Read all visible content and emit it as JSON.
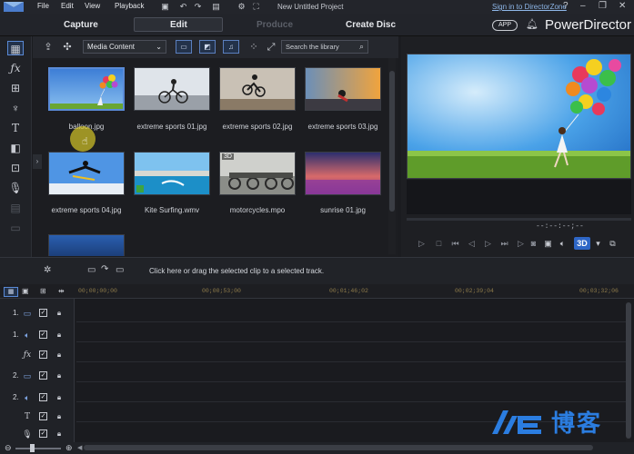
{
  "menu": [
    "File",
    "Edit",
    "View",
    "Playback"
  ],
  "window": {
    "title": "New Untitled Project",
    "signin_link": "Sign in to DirectorZone",
    "help": "?",
    "minimize": "–",
    "restore": "❐",
    "close": "✕"
  },
  "modes": {
    "capture": "Capture",
    "edit": "Edit",
    "produce": "Produce",
    "create_disc": "Create Disc"
  },
  "brand": {
    "app_badge": "APP",
    "name": "PowerDirector"
  },
  "library": {
    "dropdown_value": "Media Content",
    "search_placeholder": "Search the library",
    "items": [
      {
        "label": "balloon.jpg",
        "selected": true
      },
      {
        "label": "extreme sports 01.jpg"
      },
      {
        "label": "extreme sports 02.jpg"
      },
      {
        "label": "extreme sports 03.jpg"
      },
      {
        "label": "extreme sports 04.jpg"
      },
      {
        "label": "Kite Surfing.wmv"
      },
      {
        "label": "motorcycles.mpo",
        "badge": "3D"
      },
      {
        "label": "sunrise 01.jpg"
      }
    ]
  },
  "preview": {
    "timecode": "--:--:--;--",
    "badge_3d": "3D"
  },
  "timeline": {
    "hint": "Click here or drag the selected clip to a selected track.",
    "ruler": [
      "00;00;00;00",
      "00;00;53;00",
      "00;01;46;02",
      "00;02;39;04",
      "00;03;32;06"
    ],
    "tracks": [
      {
        "num": "1.",
        "icon": "video-track-icon"
      },
      {
        "num": "1.",
        "icon": "audio-track-icon"
      },
      {
        "num": "",
        "icon": "fx-track-icon"
      },
      {
        "num": "2.",
        "icon": "video-track-icon"
      },
      {
        "num": "2.",
        "icon": "audio-track-icon"
      },
      {
        "num": "",
        "icon": "title-track-icon"
      },
      {
        "num": "",
        "icon": "voice-track-icon"
      }
    ]
  },
  "watermark": "博客",
  "colors": {
    "background": "#1b1c20",
    "accent": "#5a8ad6",
    "link": "#8fb8ea",
    "ruler_text": "#8d7a4a",
    "badge_3d": "#2e66c6"
  }
}
